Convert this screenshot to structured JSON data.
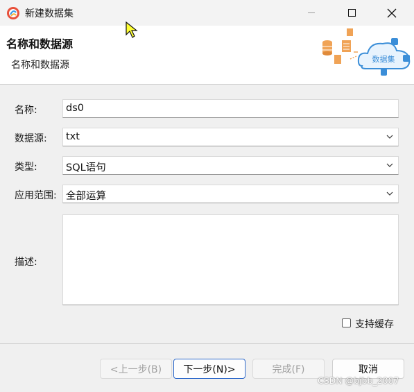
{
  "window": {
    "title": "新建数据集"
  },
  "header": {
    "title": "名称和数据源",
    "subtitle": "名称和数据源",
    "art_caption": "数据集"
  },
  "form": {
    "name": {
      "label": "名称:",
      "value": "ds0"
    },
    "datasource": {
      "label": "数据源:",
      "value": "txt"
    },
    "type": {
      "label": "类型:",
      "value": "SQL语句"
    },
    "scope": {
      "label": "应用范围:",
      "value": "全部运算"
    },
    "description": {
      "label": "描述:",
      "value": ""
    },
    "cache": {
      "label": "支持缓存",
      "checked": false
    }
  },
  "buttons": {
    "prev": "<上一步(B)",
    "next": "下一步(N)>",
    "finish": "完成(F)",
    "cancel": "取消"
  },
  "watermark": "CSDN @bjbb_2007",
  "colors": {
    "accent": "#2a66c9",
    "banner_icon": "#f0a356",
    "cloud": "#3b8ed8"
  }
}
